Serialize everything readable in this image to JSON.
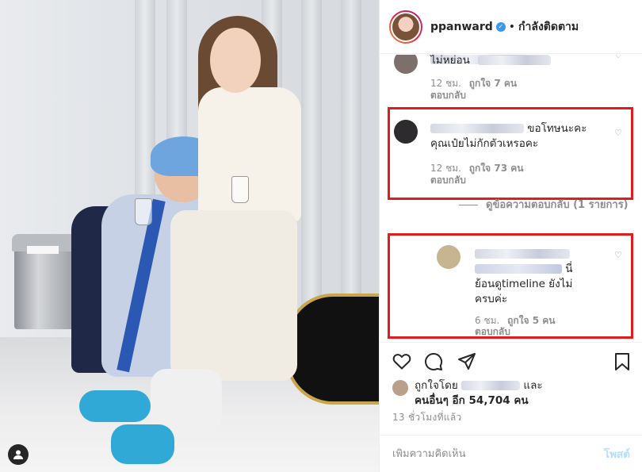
{
  "post": {
    "username": "ppanward",
    "follow_status": "กำลังติดตาม",
    "separator": "•"
  },
  "comments": [
    {
      "text": "ไม่หย่อน",
      "time": "12 ชม.",
      "likes": "ถูกใจ 7 คน",
      "reply": "ตอบกลับ"
    },
    {
      "text_line1": "ขอโทษนะคะ",
      "text_line2": "คุณเป๋ยไม่กักตัวเหรอคะ",
      "time": "12 ชม.",
      "likes": "ถูกใจ 73 คน",
      "reply": "ตอบกลับ"
    },
    {
      "text_line1": "นี่",
      "text_line2": "ย้อนดูtimeline ยังไม่",
      "text_line3": "ครบค่ะ",
      "time": "6 ชม.",
      "likes": "ถูกใจ 5 คน",
      "reply": "ตอบกลับ"
    }
  ],
  "view_replies": "ดูข้อความตอบกลับ (1 รายการ)",
  "liked_by": {
    "prefix": "ถูกใจโดย",
    "suffix": "และ",
    "others": "คนอื่นๆ อีก 54,704 คน"
  },
  "time_ago": "13 ชั่วโมงที่แล้ว",
  "add_comment": {
    "placeholder": "เพิ่มความคิดเห็น",
    "post_label": "โพสต์"
  },
  "icons": {
    "heart": "heart-icon",
    "comment": "comment-icon",
    "share": "share-icon",
    "bookmark": "bookmark-icon",
    "user_tag": "user-tag-icon",
    "verified": "verified-badge-icon"
  },
  "colors": {
    "highlight_box": "#e01d1d",
    "verified": "#3897f0",
    "post_button": "#b2dffc",
    "muted_text": "#8e8e8e"
  }
}
